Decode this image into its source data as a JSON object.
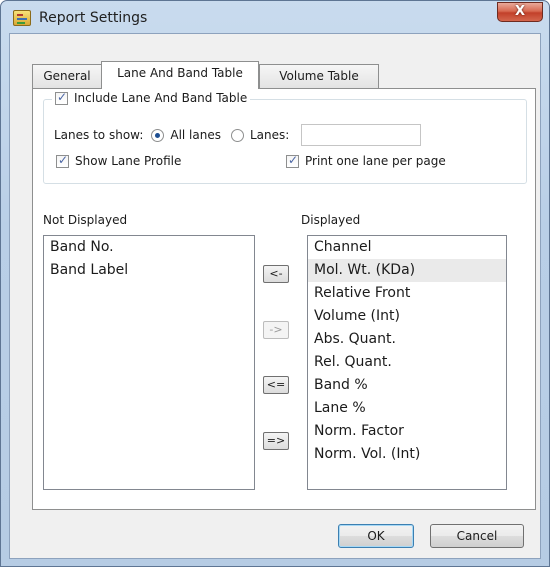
{
  "window": {
    "title": "Report Settings",
    "close_glyph": "X",
    "icon": "report-settings-icon"
  },
  "tabs": [
    {
      "label": "General",
      "active": false
    },
    {
      "label": "Lane And Band Table",
      "active": true
    },
    {
      "label": "Volume Table",
      "active": false
    }
  ],
  "group": {
    "include_label": "Include Lane And Band Table",
    "include_checked": true,
    "lanes_to_show_label": "Lanes to show:",
    "all_lanes_label": "All lanes",
    "all_lanes_selected": true,
    "lanes_label": "Lanes:",
    "lanes_value": "",
    "show_lane_profile_label": "Show Lane Profile",
    "show_lane_profile_checked": true,
    "print_one_lane_label": "Print one lane per page",
    "print_one_lane_checked": true
  },
  "not_displayed": {
    "label": "Not Displayed",
    "items": [
      "Band No.",
      "Band Label"
    ]
  },
  "displayed": {
    "label": "Displayed",
    "items": [
      "Channel",
      "Mol. Wt. (KDa)",
      "Relative Front",
      "Volume (Int)",
      "Abs. Quant.",
      "Rel. Quant.",
      "Band %",
      "Lane %",
      "Norm. Factor",
      "Norm. Vol. (Int)"
    ],
    "selected_index": 1
  },
  "move_buttons": {
    "move_left": "<-",
    "move_right": "->",
    "move_all_left": "<=",
    "move_all_right": "=>"
  },
  "footer": {
    "ok_label": "OK",
    "cancel_label": "Cancel"
  },
  "colors": {
    "accent": "#1e4f92",
    "close_button": "#c2402a",
    "frame": "#b9cfe7"
  }
}
